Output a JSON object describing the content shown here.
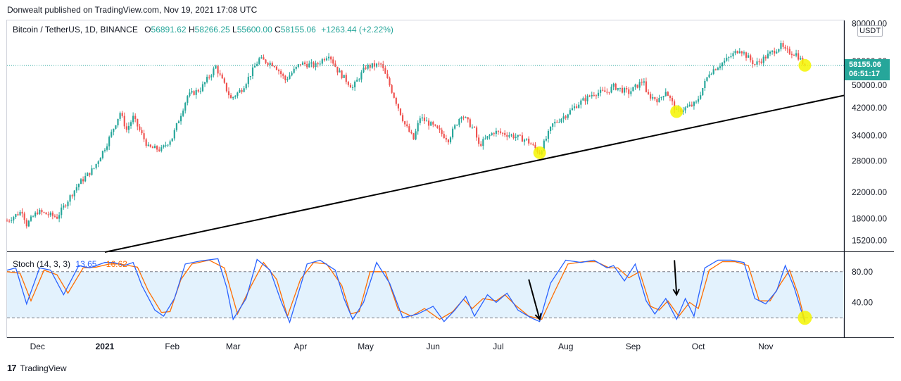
{
  "header": {
    "text": "Donwealt published on TradingView.com, Nov 19, 2021 17:08 UTC"
  },
  "legend": {
    "symbol": "Bitcoin / TetherUS, 1D, BINANCE",
    "o_label": "O",
    "o_value": "56891.62",
    "h_label": "H",
    "h_value": "58266.25",
    "l_label": "L",
    "l_value": "55600.00",
    "c_label": "C",
    "c_value": "58155.06",
    "change": "+1263.44 (+2.22%)"
  },
  "stoch_legend": {
    "name": "Stoch (14, 3, 3)",
    "k_value": "13.65",
    "d_value": "16.62"
  },
  "currency_badge": "USDT",
  "last_price": {
    "price": "58155.06",
    "countdown": "06:51:17"
  },
  "footer": {
    "brand": "TradingView",
    "logo": "17"
  },
  "colors": {
    "up": "#26a69a",
    "down": "#ef5350",
    "k_line": "#2962ff",
    "d_line": "#ff6d00",
    "band_fill": "#e3f2fd",
    "highlight": "#f5f500"
  },
  "chart_data": [
    {
      "type": "candlestick",
      "symbol": "BTCUSDT",
      "scale": "log",
      "ylim": [
        14000,
        82000
      ],
      "y_ticks": [
        80000,
        60000,
        50000,
        42000,
        34000,
        28000,
        22000,
        18000,
        15200
      ],
      "y_tick_labels": [
        "80000.00",
        "60000.00",
        "50000.00",
        "42000.00",
        "34000.00",
        "28000.00",
        "22000.00",
        "18000.00",
        "15200.00"
      ],
      "x_ticks": [
        "2020-12-01",
        "2021-01-01",
        "2021-02-01",
        "2021-03-01",
        "2021-04-01",
        "2021-05-01",
        "2021-06-01",
        "2021-07-01",
        "2021-08-01",
        "2021-09-01",
        "2021-10-01",
        "2021-11-01"
      ],
      "x_tick_labels": [
        "Dec",
        "2021",
        "Feb",
        "Mar",
        "Apr",
        "May",
        "Jun",
        "Jul",
        "Aug",
        "Sep",
        "Oct",
        "Nov"
      ],
      "x_range": [
        "2020-11-17",
        "2021-12-07"
      ],
      "closes_by_date": [
        [
          "2020-11-17",
          17700
        ],
        [
          "2020-11-24",
          19100
        ],
        [
          "2020-11-26",
          17200
        ],
        [
          "2020-12-01",
          19000
        ],
        [
          "2020-12-10",
          18200
        ],
        [
          "2020-12-16",
          21300
        ],
        [
          "2020-12-20",
          23500
        ],
        [
          "2020-12-27",
          26500
        ],
        [
          "2021-01-02",
          32000
        ],
        [
          "2021-01-08",
          40500
        ],
        [
          "2021-01-11",
          35500
        ],
        [
          "2021-01-14",
          39000
        ],
        [
          "2021-01-21",
          31000
        ],
        [
          "2021-01-27",
          30500
        ],
        [
          "2021-02-01",
          33500
        ],
        [
          "2021-02-08",
          46000
        ],
        [
          "2021-02-14",
          48500
        ],
        [
          "2021-02-21",
          57500
        ],
        [
          "2021-02-28",
          45000
        ],
        [
          "2021-03-05",
          48500
        ],
        [
          "2021-03-13",
          61000
        ],
        [
          "2021-03-20",
          58500
        ],
        [
          "2021-03-25",
          52000
        ],
        [
          "2021-04-01",
          59000
        ],
        [
          "2021-04-08",
          58000
        ],
        [
          "2021-04-14",
          63500
        ],
        [
          "2021-04-18",
          56000
        ],
        [
          "2021-04-25",
          49000
        ],
        [
          "2021-05-01",
          57500
        ],
        [
          "2021-05-08",
          58500
        ],
        [
          "2021-05-12",
          50000
        ],
        [
          "2021-05-19",
          37000
        ],
        [
          "2021-05-23",
          33000
        ],
        [
          "2021-05-26",
          39000
        ],
        [
          "2021-06-01",
          36500
        ],
        [
          "2021-06-08",
          33000
        ],
        [
          "2021-06-14",
          40000
        ],
        [
          "2021-06-20",
          35500
        ],
        [
          "2021-06-22",
          31500
        ],
        [
          "2021-06-29",
          35000
        ],
        [
          "2021-07-06",
          34200
        ],
        [
          "2021-07-14",
          32800
        ],
        [
          "2021-07-20",
          29800
        ],
        [
          "2021-07-26",
          37000
        ],
        [
          "2021-08-01",
          39800
        ],
        [
          "2021-08-07",
          43500
        ],
        [
          "2021-08-14",
          47000
        ],
        [
          "2021-08-20",
          47500
        ],
        [
          "2021-08-23",
          49500
        ],
        [
          "2021-08-30",
          47200
        ],
        [
          "2021-09-06",
          52000
        ],
        [
          "2021-09-07",
          46500
        ],
        [
          "2021-09-13",
          44500
        ],
        [
          "2021-09-16",
          48000
        ],
        [
          "2021-09-21",
          40800
        ],
        [
          "2021-09-27",
          42500
        ],
        [
          "2021-09-30",
          43500
        ],
        [
          "2021-10-06",
          55000
        ],
        [
          "2021-10-15",
          61500
        ],
        [
          "2021-10-20",
          66000
        ],
        [
          "2021-10-27",
          58500
        ],
        [
          "2021-10-31",
          61300
        ],
        [
          "2021-11-08",
          67500
        ],
        [
          "2021-11-10",
          64900
        ],
        [
          "2021-11-15",
          63500
        ],
        [
          "2021-11-19",
          58155
        ]
      ],
      "trendline": {
        "from": [
          "2021-01-01",
          14000
        ],
        "to": [
          "2021-12-07",
          46200
        ]
      },
      "highlight_circles": [
        [
          "2021-07-20",
          29800
        ],
        [
          "2021-09-21",
          40800
        ],
        [
          "2021-11-19",
          58155
        ]
      ],
      "last_price_line": 58155.06
    },
    {
      "type": "line",
      "name": "Stoch (14, 3, 3)",
      "ylim": [
        0,
        100
      ],
      "bands": [
        80,
        20
      ],
      "y_ticks": [
        80,
        40
      ],
      "y_tick_labels": [
        "80.00",
        "40.00"
      ],
      "series": [
        {
          "name": "%K",
          "points": [
            [
              "2020-11-17",
              82
            ],
            [
              "2020-11-21",
              85
            ],
            [
              "2020-11-26",
              38
            ],
            [
              "2020-12-02",
              85
            ],
            [
              "2020-12-07",
              82
            ],
            [
              "2020-12-13",
              50
            ],
            [
              "2020-12-20",
              88
            ],
            [
              "2020-12-25",
              85
            ],
            [
              "2021-01-01",
              92
            ],
            [
              "2021-01-05",
              92
            ],
            [
              "2021-01-10",
              88
            ],
            [
              "2021-01-14",
              92
            ],
            [
              "2021-01-18",
              62
            ],
            [
              "2021-01-24",
              30
            ],
            [
              "2021-01-28",
              22
            ],
            [
              "2021-02-02",
              45
            ],
            [
              "2021-02-07",
              90
            ],
            [
              "2021-02-14",
              94
            ],
            [
              "2021-02-22",
              97
            ],
            [
              "2021-02-26",
              60
            ],
            [
              "2021-03-01",
              18
            ],
            [
              "2021-03-07",
              45
            ],
            [
              "2021-03-12",
              96
            ],
            [
              "2021-03-18",
              82
            ],
            [
              "2021-03-23",
              42
            ],
            [
              "2021-03-27",
              14
            ],
            [
              "2021-04-04",
              90
            ],
            [
              "2021-04-10",
              95
            ],
            [
              "2021-04-17",
              82
            ],
            [
              "2021-04-21",
              45
            ],
            [
              "2021-04-25",
              18
            ],
            [
              "2021-04-30",
              40
            ],
            [
              "2021-05-06",
              92
            ],
            [
              "2021-05-12",
              65
            ],
            [
              "2021-05-18",
              20
            ],
            [
              "2021-05-25",
              25
            ],
            [
              "2021-06-01",
              35
            ],
            [
              "2021-06-06",
              15
            ],
            [
              "2021-06-11",
              30
            ],
            [
              "2021-06-16",
              48
            ],
            [
              "2021-06-20",
              22
            ],
            [
              "2021-06-26",
              50
            ],
            [
              "2021-06-30",
              40
            ],
            [
              "2021-07-05",
              52
            ],
            [
              "2021-07-10",
              30
            ],
            [
              "2021-07-16",
              20
            ],
            [
              "2021-07-20",
              15
            ],
            [
              "2021-07-25",
              65
            ],
            [
              "2021-08-01",
              95
            ],
            [
              "2021-08-08",
              92
            ],
            [
              "2021-08-14",
              95
            ],
            [
              "2021-08-20",
              85
            ],
            [
              "2021-08-23",
              88
            ],
            [
              "2021-08-28",
              68
            ],
            [
              "2021-09-02",
              90
            ],
            [
              "2021-09-07",
              42
            ],
            [
              "2021-09-11",
              25
            ],
            [
              "2021-09-16",
              45
            ],
            [
              "2021-09-21",
              18
            ],
            [
              "2021-09-25",
              45
            ],
            [
              "2021-09-29",
              22
            ],
            [
              "2021-10-04",
              85
            ],
            [
              "2021-10-10",
              95
            ],
            [
              "2021-10-16",
              95
            ],
            [
              "2021-10-22",
              92
            ],
            [
              "2021-10-27",
              45
            ],
            [
              "2021-11-01",
              38
            ],
            [
              "2021-11-06",
              55
            ],
            [
              "2021-11-10",
              88
            ],
            [
              "2021-11-14",
              60
            ],
            [
              "2021-11-19",
              14
            ]
          ]
        },
        {
          "name": "%D",
          "points": [
            [
              "2020-11-17",
              80
            ],
            [
              "2020-11-23",
              78
            ],
            [
              "2020-11-28",
              42
            ],
            [
              "2020-12-04",
              82
            ],
            [
              "2020-12-10",
              76
            ],
            [
              "2020-12-15",
              52
            ],
            [
              "2020-12-22",
              85
            ],
            [
              "2020-12-28",
              86
            ],
            [
              "2021-01-03",
              90
            ],
            [
              "2021-01-08",
              90
            ],
            [
              "2021-01-12",
              88
            ],
            [
              "2021-01-16",
              86
            ],
            [
              "2021-01-21",
              55
            ],
            [
              "2021-01-27",
              27
            ],
            [
              "2021-01-31",
              28
            ],
            [
              "2021-02-05",
              70
            ],
            [
              "2021-02-10",
              90
            ],
            [
              "2021-02-18",
              95
            ],
            [
              "2021-02-25",
              85
            ],
            [
              "2021-03-03",
              25
            ],
            [
              "2021-03-09",
              60
            ],
            [
              "2021-03-15",
              92
            ],
            [
              "2021-03-21",
              70
            ],
            [
              "2021-03-26",
              22
            ],
            [
              "2021-04-01",
              70
            ],
            [
              "2021-04-07",
              92
            ],
            [
              "2021-04-13",
              90
            ],
            [
              "2021-04-20",
              62
            ],
            [
              "2021-04-24",
              25
            ],
            [
              "2021-04-28",
              28
            ],
            [
              "2021-05-03",
              80
            ],
            [
              "2021-05-10",
              80
            ],
            [
              "2021-05-16",
              30
            ],
            [
              "2021-05-22",
              22
            ],
            [
              "2021-05-28",
              32
            ],
            [
              "2021-06-04",
              18
            ],
            [
              "2021-06-10",
              28
            ],
            [
              "2021-06-15",
              44
            ],
            [
              "2021-06-19",
              32
            ],
            [
              "2021-06-24",
              45
            ],
            [
              "2021-06-30",
              42
            ],
            [
              "2021-07-04",
              50
            ],
            [
              "2021-07-09",
              36
            ],
            [
              "2021-07-15",
              22
            ],
            [
              "2021-07-21",
              18
            ],
            [
              "2021-07-27",
              55
            ],
            [
              "2021-08-02",
              90
            ],
            [
              "2021-08-09",
              93
            ],
            [
              "2021-08-15",
              93
            ],
            [
              "2021-08-21",
              85
            ],
            [
              "2021-08-25",
              85
            ],
            [
              "2021-08-30",
              72
            ],
            [
              "2021-09-04",
              80
            ],
            [
              "2021-09-09",
              35
            ],
            [
              "2021-09-13",
              30
            ],
            [
              "2021-09-17",
              42
            ],
            [
              "2021-09-22",
              22
            ],
            [
              "2021-09-27",
              40
            ],
            [
              "2021-10-01",
              32
            ],
            [
              "2021-10-06",
              82
            ],
            [
              "2021-10-12",
              93
            ],
            [
              "2021-10-18",
              93
            ],
            [
              "2021-10-24",
              88
            ],
            [
              "2021-10-29",
              42
            ],
            [
              "2021-11-03",
              42
            ],
            [
              "2021-11-08",
              65
            ],
            [
              "2021-11-12",
              82
            ],
            [
              "2021-11-16",
              50
            ],
            [
              "2021-11-19",
              16.62
            ]
          ]
        }
      ],
      "arrows": [
        {
          "from": [
            "2021-07-15",
            70
          ],
          "to": [
            "2021-07-20",
            18
          ]
        },
        {
          "from": [
            "2021-09-20",
            95
          ],
          "to": [
            "2021-09-21",
            50
          ]
        }
      ],
      "highlight_circles": [
        [
          "2021-11-19",
          20
        ]
      ]
    }
  ]
}
